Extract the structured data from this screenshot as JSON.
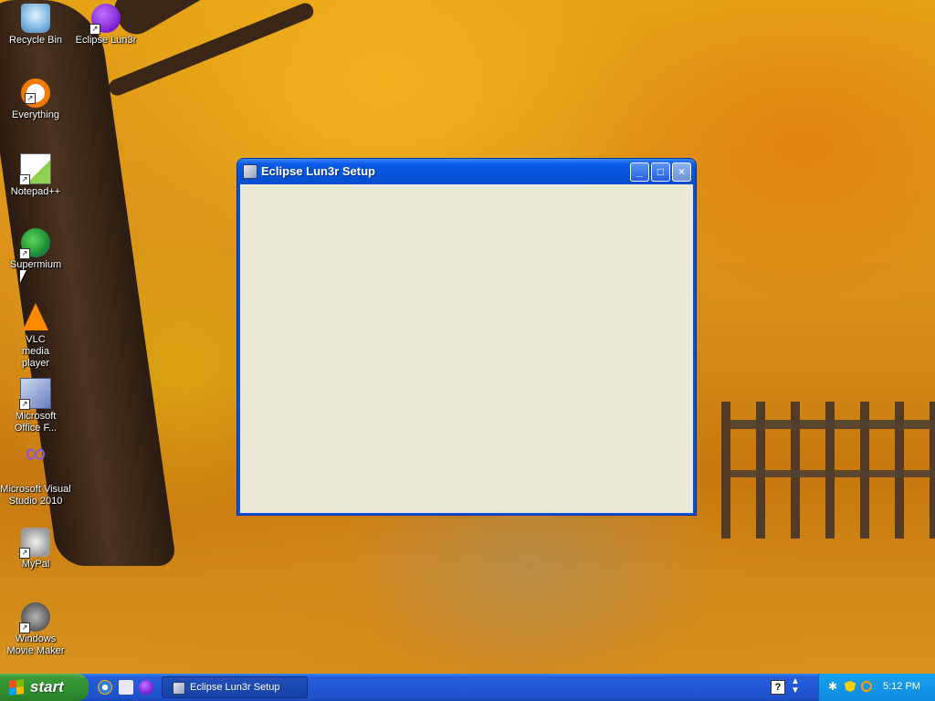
{
  "desktop": {
    "icons": [
      {
        "label": "Recycle Bin",
        "icon": "recycle-bin-icon"
      },
      {
        "label": "Eclipse Lun3r",
        "icon": "eclipse-icon"
      },
      {
        "label": "Everything",
        "icon": "everything-icon"
      },
      {
        "label": "Notepad++",
        "icon": "notepad-plus-plus-icon"
      },
      {
        "label": "Supermium",
        "icon": "supermium-icon"
      },
      {
        "label": "VLC media player",
        "icon": "vlc-icon"
      },
      {
        "label": "Microsoft Office F...",
        "icon": "office-icon"
      },
      {
        "label": "Microsoft Visual Studio 2010",
        "icon": "visual-studio-icon"
      },
      {
        "label": "MyPal",
        "icon": "mypal-icon"
      },
      {
        "label": "Windows Movie Maker",
        "icon": "movie-maker-icon"
      }
    ]
  },
  "window": {
    "title": "Eclipse Lun3r Setup",
    "buttons": {
      "minimize": "_",
      "maximize": "□",
      "close": "×"
    }
  },
  "taskbar": {
    "start_label": "start",
    "quick_launch": [
      "internet-explorer-icon",
      "document-icon",
      "eclipse-icon"
    ],
    "tasks": [
      {
        "label": "Eclipse Lun3r Setup",
        "active": false
      }
    ],
    "help_glyph": "?",
    "tray": {
      "clock": "5:12 PM",
      "icons": [
        "network-icon",
        "shield-icon",
        "search-icon"
      ]
    }
  },
  "colors": {
    "taskbar": "#245edb",
    "start": "#3a9a3a",
    "window_title": "#0552d8",
    "window_client": "#ece9d8",
    "tray": "#0f8be0"
  }
}
